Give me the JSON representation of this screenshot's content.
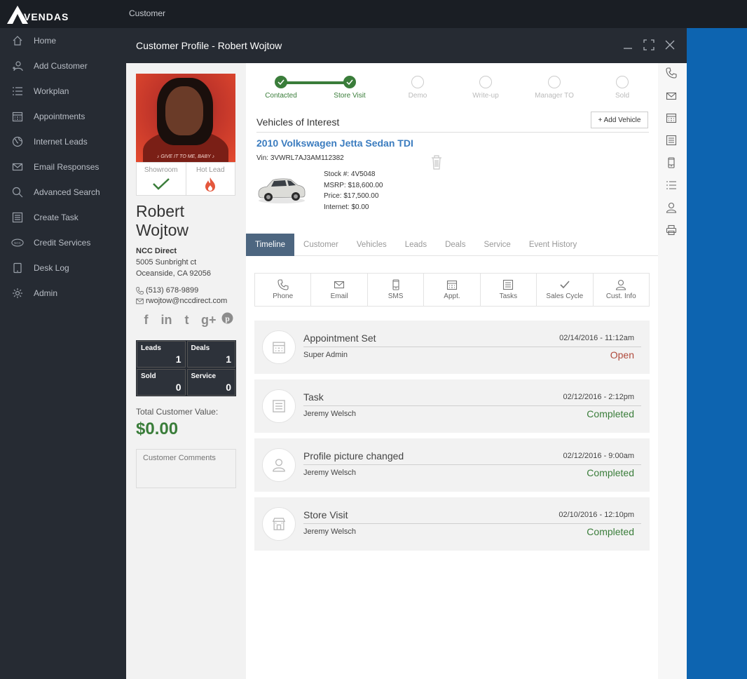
{
  "brand": {
    "logo_text": "VENDAS"
  },
  "breadcrumb": "Customer",
  "nav": [
    {
      "label": "Home",
      "icon": "home-icon"
    },
    {
      "label": "Add Customer",
      "icon": "add-user-icon"
    },
    {
      "label": "Workplan",
      "icon": "list-icon"
    },
    {
      "label": "Appointments",
      "icon": "calendar-icon"
    },
    {
      "label": "Internet Leads",
      "icon": "globe-icon"
    },
    {
      "label": "Email Responses",
      "icon": "envelope-icon"
    },
    {
      "label": "Advanced Search",
      "icon": "search-icon"
    },
    {
      "label": "Create Task",
      "icon": "task-icon"
    },
    {
      "label": "Credit Services",
      "icon": "ncc-icon"
    },
    {
      "label": "Desk Log",
      "icon": "tablet-icon"
    },
    {
      "label": "Admin",
      "icon": "gear-icon"
    }
  ],
  "modal": {
    "title": "Customer Profile - Robert Wojtow"
  },
  "profile": {
    "photo_caption": "♪ GIVE IT TO ME, BABY ♪",
    "showroom_label": "Showroom",
    "hot_lead_label": "Hot Lead",
    "first_name": "Robert",
    "last_name": "Wojtow",
    "company": "NCC Direct",
    "address1": "5005 Sunbright ct",
    "address2": "Oceanside, CA 92056",
    "phone": "(513) 678-9899",
    "email": "rwojtow@nccdirect.com",
    "social": [
      "facebook-icon",
      "linkedin-icon",
      "tumblr-icon",
      "google-plus-icon",
      "pinterest-icon"
    ],
    "stats": {
      "leads_label": "Leads",
      "leads": "1",
      "deals_label": "Deals",
      "deals": "1",
      "sold_label": "Sold",
      "sold": "0",
      "service_label": "Service",
      "service": "0"
    },
    "total_value_label": "Total Customer Value:",
    "total_value": "$0.00",
    "comments_placeholder": "Customer Comments"
  },
  "progress": {
    "steps": [
      {
        "label": "Contacted",
        "done": true
      },
      {
        "label": "Store Visit",
        "done": true
      },
      {
        "label": "Demo",
        "done": false
      },
      {
        "label": "Write-up",
        "done": false
      },
      {
        "label": "Manager TO",
        "done": false
      },
      {
        "label": "Sold",
        "done": false
      }
    ]
  },
  "vehicles": {
    "section_title": "Vehicles of Interest",
    "add_button": "+ Add Vehicle",
    "item": {
      "title": "2010 Volkswagen Jetta Sedan TDI",
      "vin": "Vin: 3VWRL7AJ3AM112382",
      "stock": "Stock #: 4V5048",
      "msrp": "MSRP: $18,600.00",
      "price": "Price: $17,500.00",
      "internet": "Internet: $0.00"
    }
  },
  "tabs": [
    "Timeline",
    "Customer",
    "Vehicles",
    "Leads",
    "Deals",
    "Service",
    "Event History"
  ],
  "actions": [
    {
      "label": "Phone",
      "icon": "phone-icon"
    },
    {
      "label": "Email",
      "icon": "envelope-icon"
    },
    {
      "label": "SMS",
      "icon": "mobile-icon"
    },
    {
      "label": "Appt.",
      "icon": "calendar-icon"
    },
    {
      "label": "Tasks",
      "icon": "task-icon"
    },
    {
      "label": "Sales Cycle",
      "icon": "check-icon"
    },
    {
      "label": "Cust. Info",
      "icon": "user-icon"
    }
  ],
  "timeline": [
    {
      "title": "Appointment Set",
      "date": "02/14/2016 - 11:12am",
      "user": "Super Admin",
      "status": "Open",
      "icon": "calendar-icon"
    },
    {
      "title": "Task",
      "date": "02/12/2016 - 2:12pm",
      "user": "Jeremy Welsch",
      "status": "Completed",
      "icon": "task-icon"
    },
    {
      "title": "Profile picture changed",
      "date": "02/12/2016 - 9:00am",
      "user": "Jeremy Welsch",
      "status": "Completed",
      "icon": "user-icon"
    },
    {
      "title": "Store Visit",
      "date": "02/10/2016 - 12:10pm",
      "user": "Jeremy Welsch",
      "status": "Completed",
      "icon": "store-icon"
    }
  ],
  "rail": [
    "phone-icon",
    "envelope-icon",
    "calendar-icon",
    "task-icon",
    "mobile-icon",
    "list-icon",
    "user-icon",
    "printer-icon"
  ],
  "colors": {
    "accent_green": "#3a7d3a",
    "link_blue": "#3b7cbf",
    "tab_active": "#4d6680",
    "status_open": "#b04a3c",
    "side_blue": "#0d64b0"
  }
}
